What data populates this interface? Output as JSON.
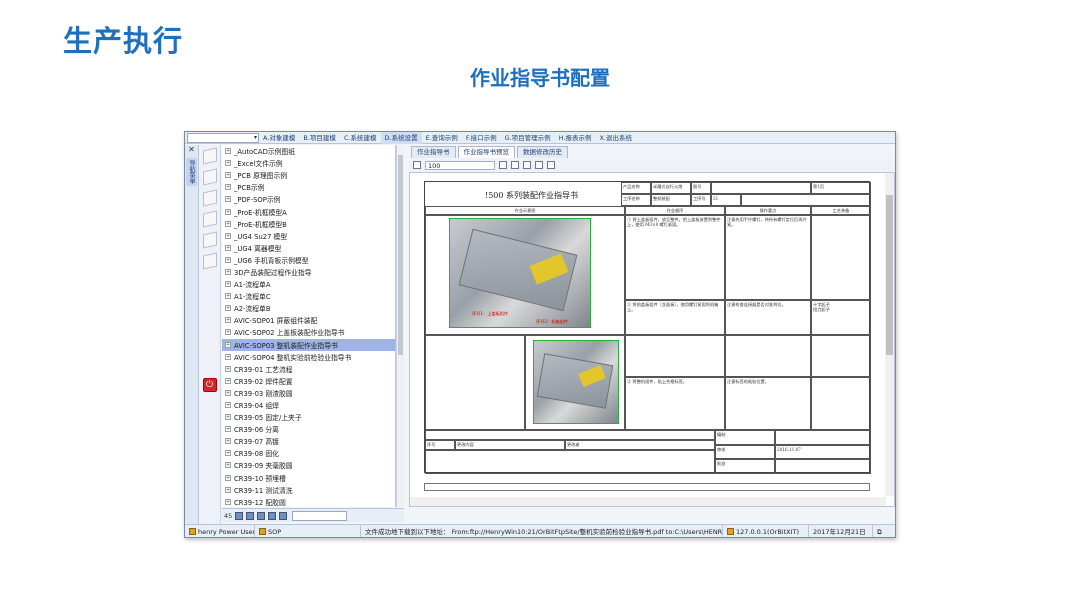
{
  "slide": {
    "title": "生产执行",
    "subtitle": "作业指导书配置"
  },
  "menubar": {
    "combo_value": "▾",
    "items": [
      "A.对象建模",
      "B.项目建模",
      "C.系统建模",
      "D.系统设置",
      "E.查询示例",
      "F.接口示例",
      "G.项目管理示例",
      "H.报表示例",
      "X.退出系统"
    ]
  },
  "left_strip": {
    "close": "✕",
    "vertical_tab": "导航菜单"
  },
  "tree": {
    "items": [
      "_AutoCAD示例图纸",
      "_Excel文件示例",
      "_PCB 原理图示例",
      "_PCB示例",
      "_PDF-SOP示例",
      "_ProE-机框模型A",
      "_ProE-机框模型B",
      "_UG4 Su27 模型",
      "_UG4 离器模型",
      "_UG6 手机背板示例模型",
      "3D产品装配过程作业指导",
      "A1-流程单A",
      "A1-流程单C",
      "A2-流程单B",
      "AVIC-SOP01 屏蔽组件装配",
      "AVIC-SOP02 上盖板装配作业指导书",
      "AVIC-SOP03 整机装配作业指导书",
      "AVIC-SOP04 整机实验前检验业指导书",
      "CR39-01 工艺流程",
      "CR39-02 焊件配置",
      "CR39-03 刚渣胶圆",
      "CR39-04 组焊",
      "CR39-05 固定/上夹子",
      "CR39-06 分离",
      "CR39-07 高镀",
      "CR39-08 固化",
      "CR39-09 夹毫胶圆",
      "CR39-10 预埋槽",
      "CR39-11 测试清洗",
      "CR39-12 配胶圆"
    ],
    "selected_index": 16,
    "footer_count": "45"
  },
  "doc": {
    "tabs": [
      "作业指导书",
      "作业指导书预览",
      "数据修改历史"
    ],
    "active_tab": 1,
    "zoom": "100",
    "sheet": {
      "title": "!500 系列装配作业指导书",
      "h_product": "产品名称",
      "h_product_val": "半履式自行火炮",
      "h_drawing": "图号",
      "h_pages": "第1页",
      "h_process": "工序名称",
      "h_process_val": "整机装配",
      "h_process_no": "工序号",
      "h_process_no_val": "21",
      "col_diagram": "作业示意图",
      "col_steps": "作业顺序",
      "col_points": "操作要点",
      "col_equip": "工艺装备",
      "step1": "① 将上盖板组件，放至整件。把上盖板放置到整件上，使用 M3×8 螺钉紧固。",
      "step1_note": "注意先用手拧螺钉，待所有螺钉定位后再拧紧。",
      "step2": "② 将前盖板组件（含面板），使用螺钉紧固到机箱上。",
      "step2_note": "注意检查连接器是否对准到位。",
      "step3": "③ 将整机组件，贴上合格标签。",
      "step3_note": "注意标签的粘贴位置。",
      "equip1": "十字起子",
      "equip2": "扭力起子",
      "label_a": "序号1：上盖板组件",
      "label_b": "序号2：机箱组件",
      "sig_compile": "编制",
      "sig_check": "审核",
      "sig_approve": "批准",
      "date": "2016.11.07",
      "rev_no": "序号",
      "rev_content": "更改内容",
      "rev_by": "更改者"
    }
  },
  "statusbar": {
    "user": "henry Power User",
    "module": "SOP",
    "message": "文件成功地下载到以下地址：  From:ftp://HenryWin10:21/OrBitFtpSite/整机实验前检验业指导书.pdf to:C:\\Users\\HENRYH~1\\",
    "server": "127.0.0.1(OrBitXIT)",
    "date": "2017年12月21日"
  },
  "colors": {
    "accent": "#1f6fc1",
    "selection": "#9fb3e6",
    "photo_border": "#2cae3a"
  }
}
